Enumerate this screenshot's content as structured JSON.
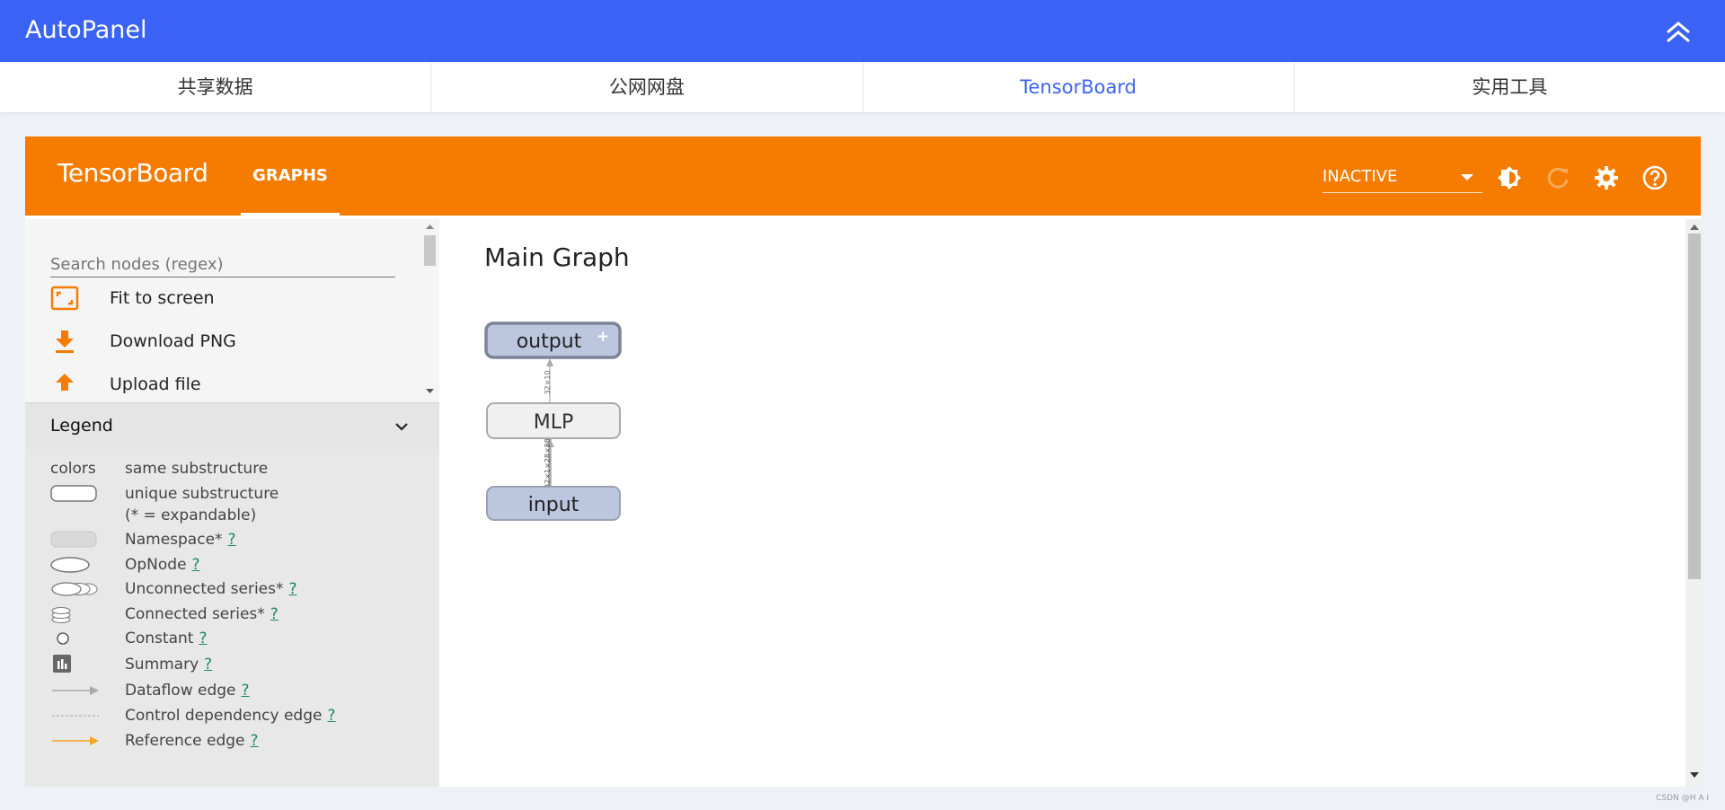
{
  "app": {
    "title": "AutoPanel"
  },
  "tabs": [
    {
      "label": "共享数据"
    },
    {
      "label": "公网网盘"
    },
    {
      "label": "TensorBoard"
    },
    {
      "label": "实用工具"
    }
  ],
  "active_tab": "TensorBoard",
  "tensorboard": {
    "brand": "TensorBoard",
    "nav": {
      "graphs": "GRAPHS"
    },
    "run_select": {
      "value": "INACTIVE"
    },
    "icons": [
      "brightness-icon",
      "reload-icon",
      "settings-icon",
      "help-icon"
    ]
  },
  "sidebar": {
    "search_placeholder": "Search nodes (regex)",
    "controls": [
      {
        "label": "Fit to screen",
        "icon": "fit-to-screen-icon"
      },
      {
        "label": "Download PNG",
        "icon": "download-icon"
      },
      {
        "label": "Upload file",
        "icon": "upload-icon"
      }
    ],
    "legend": {
      "title": "Legend",
      "colors_label": "colors",
      "colors_value": "same substructure",
      "items": [
        {
          "label": "unique substructure",
          "help": ""
        },
        {
          "label": "(* = expandable)",
          "help": ""
        },
        {
          "label": "Namespace*",
          "help": "?"
        },
        {
          "label": "OpNode",
          "help": "?"
        },
        {
          "label": "Unconnected series*",
          "help": "?"
        },
        {
          "label": "Connected series*",
          "help": "?"
        },
        {
          "label": "Constant",
          "help": "?"
        },
        {
          "label": "Summary",
          "help": "?"
        },
        {
          "label": "Dataflow edge",
          "help": "?"
        },
        {
          "label": "Control dependency edge",
          "help": "?"
        },
        {
          "label": "Reference edge",
          "help": "?"
        }
      ]
    }
  },
  "graph": {
    "title": "Main Graph",
    "nodes": [
      {
        "label": "output",
        "expandable": "+"
      },
      {
        "label": "MLP"
      },
      {
        "label": "input"
      }
    ],
    "edges": [
      {
        "label": "32×10"
      },
      {
        "label": "32×1×28×28"
      }
    ]
  },
  "colors": {
    "header_blue": "#3a63f5",
    "tb_orange": "#f57c00",
    "node_fill": "#bcc6de",
    "node_stroke": "#9aa1b3"
  },
  "watermark": "CSDN @H A I"
}
